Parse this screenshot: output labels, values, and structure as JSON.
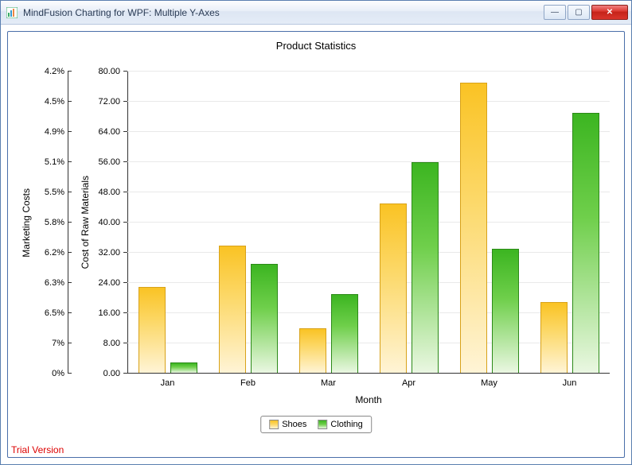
{
  "window": {
    "title": "MindFusion Charting for WPF: Multiple Y-Axes",
    "minimize_glyph": "—",
    "maximize_glyph": "▢",
    "close_glyph": "✕"
  },
  "chart": {
    "title": "Product Statistics",
    "xaxis_label": "Month",
    "y1_label": "Marketing Costs",
    "y2_label": "Cost of Raw Materials",
    "trial_text": "Trial Version"
  },
  "legend": {
    "series1": "Shoes",
    "series2": "Clothing"
  },
  "chart_data": {
    "type": "bar",
    "title": "Product Statistics",
    "xlabel": "Month",
    "categories": [
      "Jan",
      "Feb",
      "Mar",
      "Apr",
      "May",
      "Jun"
    ],
    "series": [
      {
        "name": "Shoes",
        "values": [
          23,
          34,
          12,
          45,
          77,
          19
        ]
      },
      {
        "name": "Clothing",
        "values": [
          3,
          29,
          21,
          56,
          33,
          69
        ]
      }
    ],
    "y_left": {
      "label": "Marketing Costs",
      "ticks": [
        "0%",
        "7%",
        "6.5%",
        "6.3%",
        "6.2%",
        "5.8%",
        "5.5%",
        "5.1%",
        "4.9%",
        "4.5%",
        "4.2%"
      ]
    },
    "y_right": {
      "label": "Cost of Raw Materials",
      "min": 0,
      "max": 80,
      "step": 8,
      "ticks": [
        0.0,
        8.0,
        16.0,
        24.0,
        32.0,
        40.0,
        48.0,
        56.0,
        64.0,
        72.0,
        80.0
      ]
    },
    "legend_position": "bottom",
    "grid": "horizontal"
  }
}
